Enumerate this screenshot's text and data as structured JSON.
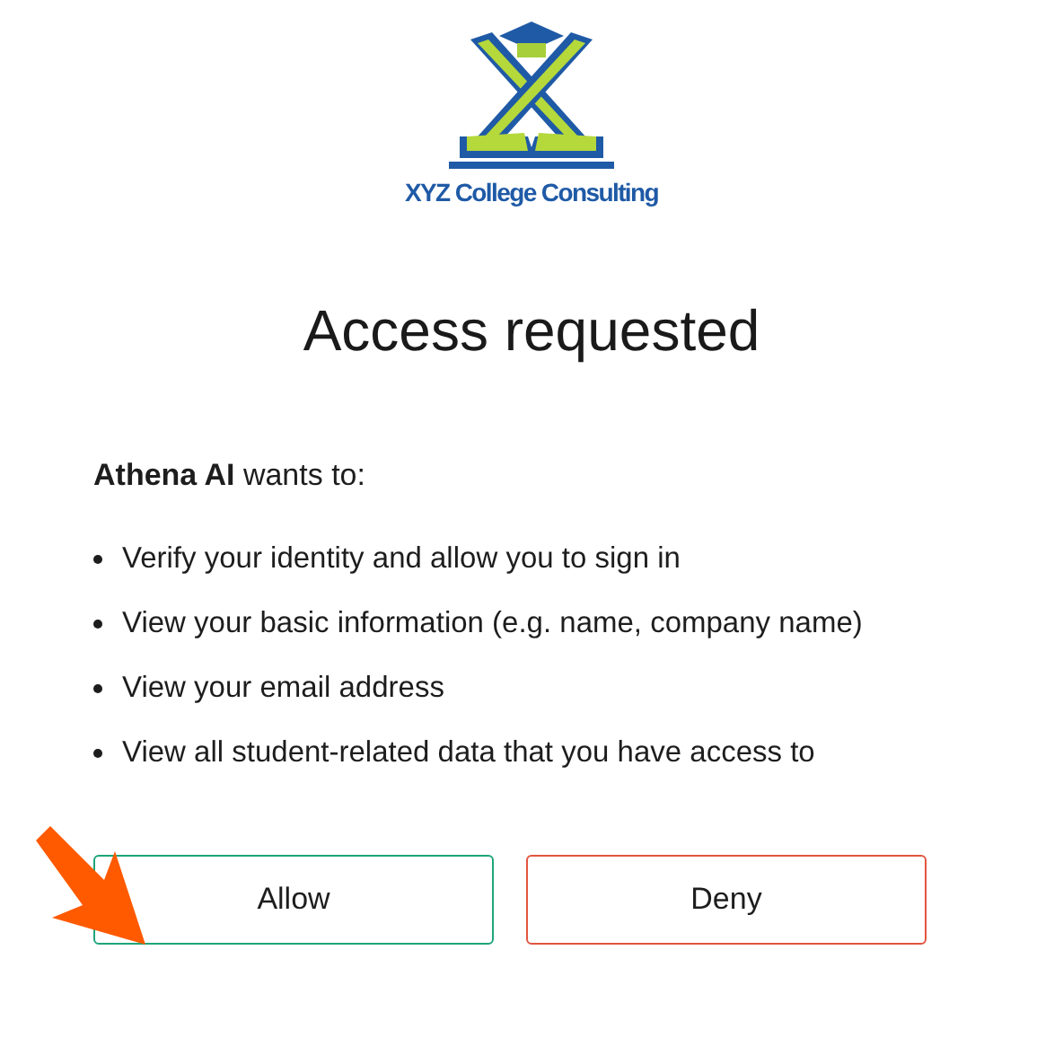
{
  "logo": {
    "name": "XYZ College Consulting"
  },
  "title": "Access requested",
  "intro": "**Athena AI** wants to:",
  "permissions": [
    "Verify your identity and allow you to sign in",
    "View your basic information (e.g. name, company name)",
    "View your email address",
    "View all student-related data that you have access to"
  ],
  "buttons": [
    {
      "label": "Allow",
      "kind": "allow"
    },
    {
      "label": "Deny",
      "kind": "deny"
    }
  ]
}
